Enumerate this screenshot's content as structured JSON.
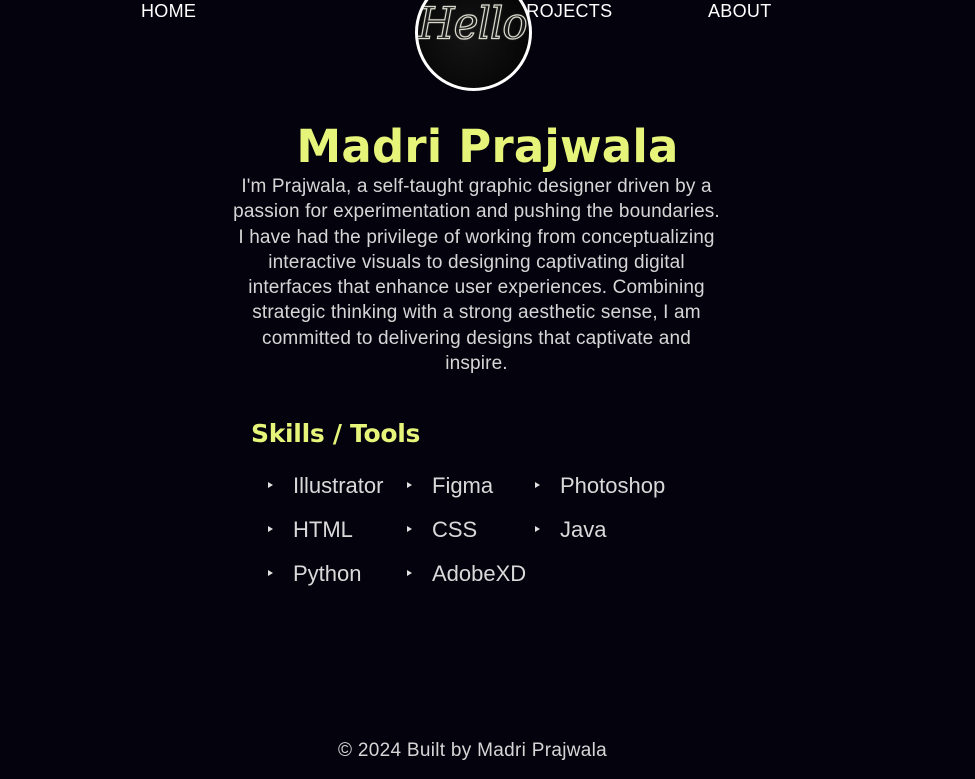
{
  "nav": {
    "home": "HOME",
    "projects": "PROJECTS",
    "about": "ABOUT"
  },
  "logo": {
    "text": "Hello!"
  },
  "hero": {
    "name": "Madri Prajwala",
    "bio": "I'm Prajwala, a self-taught graphic designer driven by a passion for experimentation and pushing the boundaries. I have had the privilege of working from conceptualizing interactive visuals to designing captivating digital interfaces that enhance user experiences. Combining strategic thinking with a strong aesthetic sense, I am committed to delivering designs that captivate and inspire."
  },
  "skills": {
    "title": "Skills / Tools",
    "items": [
      "Illustrator",
      "Figma",
      "Photoshop",
      "HTML",
      "CSS",
      "Java",
      "Python",
      "AdobeXD"
    ]
  },
  "footer": {
    "text": "© 2024 Built by Madri Prajwala"
  },
  "colors": {
    "background": "#03020d",
    "accent": "#e6f47a",
    "text": "#d6d6d6",
    "nav_text": "#ffffff"
  }
}
